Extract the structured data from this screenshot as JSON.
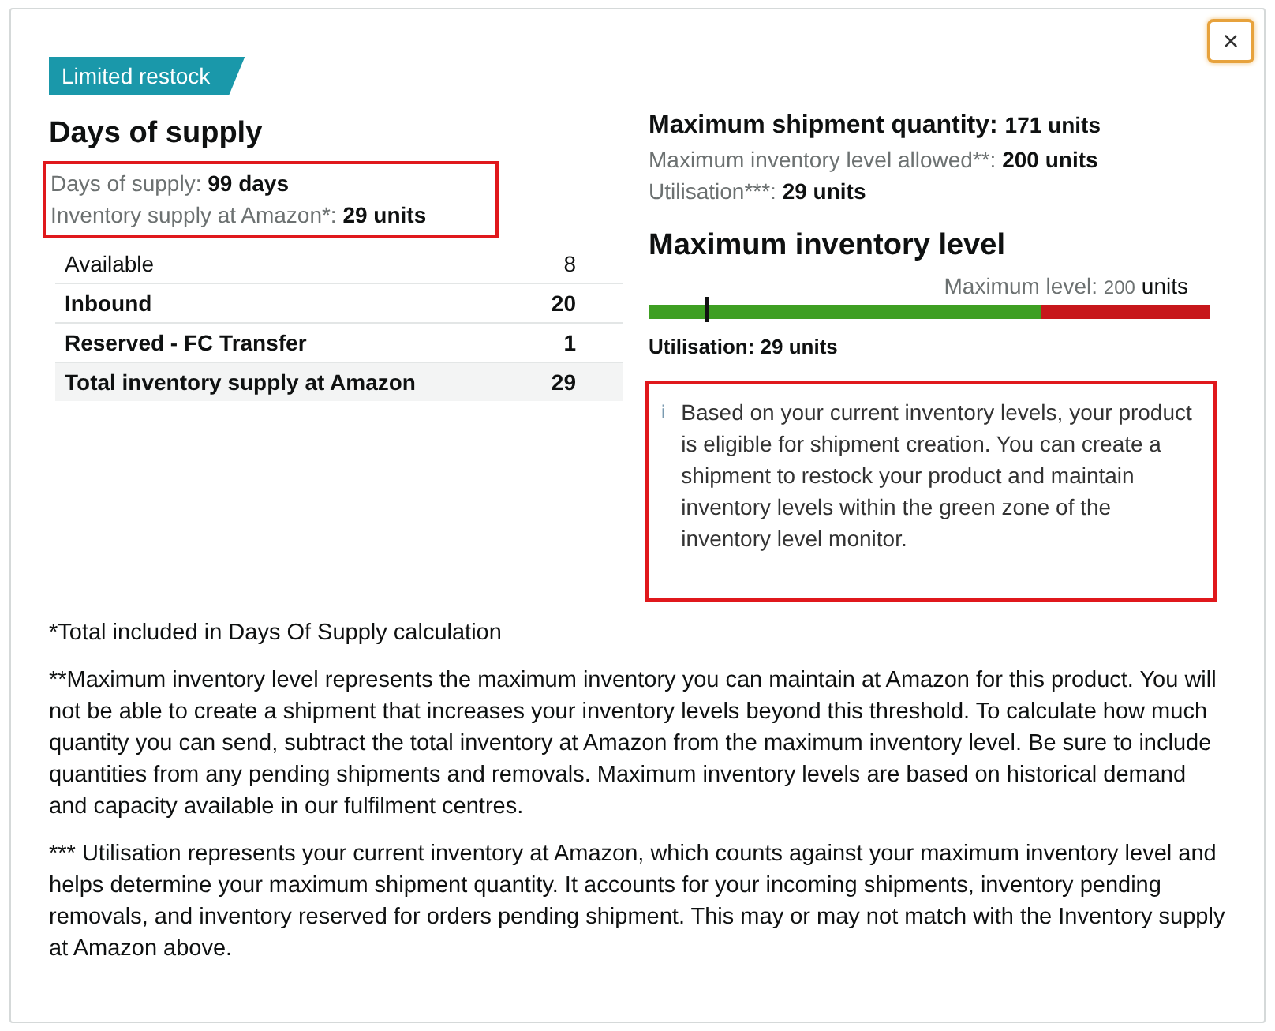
{
  "close_button": {
    "label": "×"
  },
  "badge": {
    "label": "Limited restock"
  },
  "left": {
    "title": "Days of supply",
    "summary": {
      "highlighted": true,
      "lines": [
        {
          "label": "Days of supply: ",
          "value": "99 days"
        },
        {
          "label": "Inventory supply at Amazon*: ",
          "value": "29 units"
        }
      ]
    },
    "table": {
      "rows": [
        {
          "label": "Available",
          "value": "8",
          "kind": "plain"
        },
        {
          "label": "Inbound",
          "value": "20",
          "kind": "bold"
        },
        {
          "label": "Reserved - FC Transfer",
          "value": "1",
          "kind": "bold"
        },
        {
          "label": "Total inventory supply at Amazon",
          "value": "29",
          "kind": "total"
        }
      ]
    }
  },
  "right": {
    "max_shipment": {
      "label": "Maximum shipment quantity: ",
      "value": "171",
      "unit": "units"
    },
    "lines": [
      {
        "label": "Maximum inventory level allowed**: ",
        "value": "200 units"
      },
      {
        "label": "Utilisation***: ",
        "value": "29 units"
      }
    ],
    "gauge": {
      "title": "Maximum inventory level",
      "max_label": "Maximum level: ",
      "max_value": "200",
      "max_unit": "units",
      "green_zone": {
        "level": 0.7
      },
      "marker": {
        "level": 0.1
      },
      "caption": "Utilisation: 29 units"
    },
    "info": {
      "highlighted": true,
      "icon": "i",
      "text": "Based on your current inventory levels, your product is eligible for shipment creation. You can create a shipment to restock your product and maintain inventory levels within the green zone of the inventory level monitor."
    }
  },
  "footnotes": [
    "*Total included in Days Of Supply calculation",
    "**Maximum inventory level represents the maximum inventory you can maintain at Amazon for this product. You will not be able to create a shipment that increases your inventory levels beyond this threshold. To calculate how much quantity you can send, subtract the total inventory at Amazon from the maximum inventory level. Be sure to include quantities from any pending shipments and removals. Maximum inventory levels are based on historical demand and capacity available in our fulfilment centres.",
    "*** Utilisation represents your current inventory at Amazon, which counts against your maximum inventory level and helps determine your maximum shipment quantity. It accounts for your incoming shipments, inventory pending removals, and inventory reserved for orders pending shipment. This may or may not match with the Inventory supply at Amazon above."
  ]
}
